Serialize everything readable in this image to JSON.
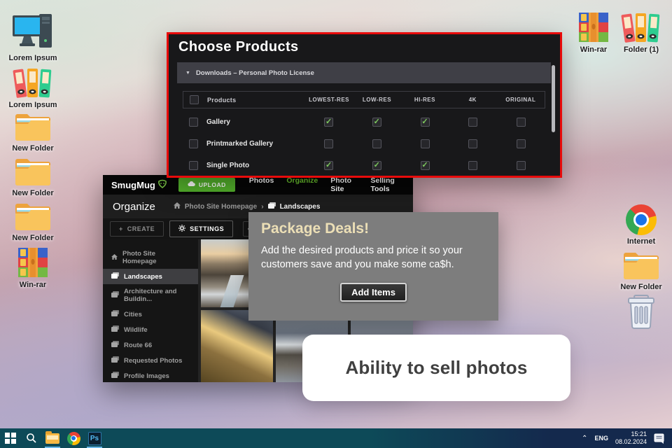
{
  "icons": {
    "check": "✓",
    "triangle_down": "▼",
    "breadcrumb_sep": "›",
    "plus": "+",
    "chevron_up": "⌃",
    "ps_label": "Ps"
  },
  "desktop": {
    "left_icons": [
      {
        "label": "Lorem Ipsum",
        "icon": "computer-icon"
      },
      {
        "label": "Lorem Ipsum",
        "icon": "binders-icon"
      },
      {
        "label": "New Folder",
        "icon": "folder-icon"
      },
      {
        "label": "New Folder",
        "icon": "folder-icon"
      },
      {
        "label": "New Folder",
        "icon": "folder-icon"
      },
      {
        "label": "Win-rar",
        "icon": "winrar-icon"
      }
    ],
    "right_top_icons": [
      {
        "label": "Win-rar",
        "icon": "winrar-icon"
      },
      {
        "label": "Folder (1)",
        "icon": "binders-icon"
      }
    ],
    "right_icons": [
      {
        "label": "Internet",
        "icon": "chrome-icon"
      },
      {
        "label": "New Folder",
        "icon": "folder-icon"
      },
      {
        "label": "",
        "icon": "trash-icon"
      }
    ]
  },
  "dialog": {
    "title": "Choose Products",
    "section_label": "Downloads – Personal Photo License",
    "columns": [
      "Products",
      "LOWEST-RES",
      "LOW-RES",
      "HI-RES",
      "4K",
      "ORIGINAL"
    ],
    "rows": [
      {
        "name": "Gallery",
        "checks": [
          true,
          true,
          true,
          false,
          false
        ]
      },
      {
        "name": "Printmarked Gallery",
        "checks": [
          false,
          false,
          false,
          false,
          false
        ]
      },
      {
        "name": "Single Photo",
        "checks": [
          true,
          true,
          true,
          false,
          false
        ]
      }
    ]
  },
  "smugmug": {
    "logo_text": "SmugMug",
    "upload_label": "UPLOAD",
    "nav": [
      {
        "label": "Photos"
      },
      {
        "label": "Organize"
      },
      {
        "label": "Photo Site"
      },
      {
        "label": "Selling Tools"
      }
    ],
    "active_nav": "Organize",
    "page_title": "Organize",
    "breadcrumb": [
      {
        "label": "Photo Site Homepage"
      },
      {
        "label": "Landscapes"
      }
    ],
    "toolbar": {
      "create_label": "CREATE",
      "settings_label": "SETTINGS"
    },
    "sidebar": [
      {
        "label": "Photo Site Homepage",
        "selected": false
      },
      {
        "label": "Landscapes",
        "selected": true
      },
      {
        "label": "Architecture and Buildin...",
        "selected": false
      },
      {
        "label": "Cities",
        "selected": false
      },
      {
        "label": "Wildlife",
        "selected": false
      },
      {
        "label": "Route 66",
        "selected": false
      },
      {
        "label": "Requested Photos",
        "selected": false
      },
      {
        "label": "Profile Images",
        "selected": false
      }
    ]
  },
  "popup": {
    "title": "Package Deals!",
    "body": "Add the desired products and price it so your customers save and you make some ca$h.",
    "button_label": "Add Items"
  },
  "card": {
    "text": "Ability to sell photos"
  },
  "taskbar": {
    "lang": "ENG",
    "time": "15:21",
    "date": "08.02.2024"
  }
}
